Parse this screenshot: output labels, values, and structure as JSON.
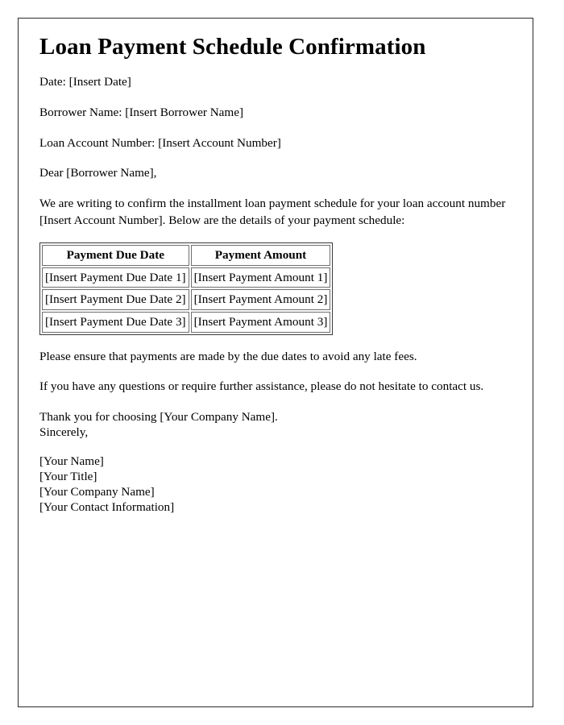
{
  "document": {
    "title": "Loan Payment Schedule Confirmation",
    "fields": {
      "date_line": "Date: [Insert Date]",
      "borrower_line": "Borrower Name: [Insert Borrower Name]",
      "account_line": "Loan Account Number: [Insert Account Number]",
      "salutation": "Dear [Borrower Name],"
    },
    "intro_paragraph": "We are writing to confirm the installment loan payment schedule for your loan account number [Insert Account Number]. Below are the details of your payment schedule:",
    "table": {
      "headers": [
        "Payment Due Date",
        "Payment Amount"
      ],
      "rows": [
        [
          "[Insert Payment Due Date 1]",
          "[Insert Payment Amount 1]"
        ],
        [
          "[Insert Payment Due Date 2]",
          "[Insert Payment Amount 2]"
        ],
        [
          "[Insert Payment Due Date 3]",
          "[Insert Payment Amount 3]"
        ]
      ]
    },
    "notice_paragraph": "Please ensure that payments are made by the due dates to avoid any late fees.",
    "contact_paragraph": "If you have any questions or require further assistance, please do not hesitate to contact us.",
    "closing": {
      "thank_you": "Thank you for choosing [Your Company Name].",
      "sign_off": "Sincerely,"
    },
    "signature": {
      "name": "[Your Name]",
      "title_line": "[Your Title]",
      "company": "[Your Company Name]",
      "contact": "[Your Contact Information]"
    }
  },
  "style": {
    "text_color": "#000000",
    "page_background": "#ffffff",
    "frame_border_color": "#2b2b2b",
    "table_border_color": "#6e6e6e"
  }
}
